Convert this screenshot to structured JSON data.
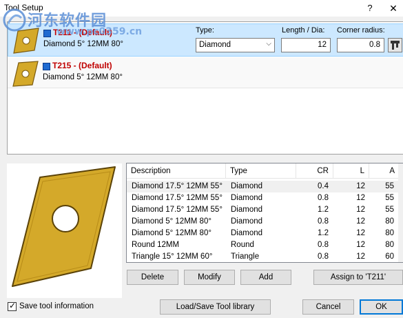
{
  "window": {
    "title": "Tool Setup",
    "help_label": "?",
    "close_label": "✕"
  },
  "watermark": {
    "text": "河东软件园",
    "url": "www.pc0359.cn"
  },
  "tools": [
    {
      "name": "T211 - (Default)",
      "description": "Diamond 5° 12MM 80°",
      "color": "#1f6bd1"
    },
    {
      "name": "T215 - (Default)",
      "description": "Diamond 5° 12MM 80°",
      "color": "#1f6bd1"
    }
  ],
  "selected_tool": {
    "type_label": "Type:",
    "type_value": "Diamond",
    "length_label": "Length / Dia:",
    "length_value": "12",
    "corner_label": "Corner radius:",
    "corner_value": "0.8"
  },
  "library": {
    "columns": [
      "Description",
      "Type",
      "CR",
      "L",
      "A"
    ],
    "rows": [
      [
        "Diamond 17.5° 12MM 55°",
        "Diamond",
        "0.4",
        "12",
        "55"
      ],
      [
        "Diamond 17.5° 12MM 55°",
        "Diamond",
        "0.8",
        "12",
        "55"
      ],
      [
        "Diamond 17.5° 12MM 55°",
        "Diamond",
        "1.2",
        "12",
        "55"
      ],
      [
        "Diamond 5° 12MM 80°",
        "Diamond",
        "0.8",
        "12",
        "80"
      ],
      [
        "Diamond 5° 12MM 80°",
        "Diamond",
        "1.2",
        "12",
        "80"
      ],
      [
        "Round 12MM",
        "Round",
        "0.8",
        "12",
        "80"
      ],
      [
        "Triangle 15° 12MM 60°",
        "Triangle",
        "0.8",
        "12",
        "60"
      ]
    ]
  },
  "buttons": {
    "delete": "Delete",
    "modify": "Modify",
    "add": "Add",
    "assign": "Assign to 'T211'",
    "load_save": "Load/Save Tool library",
    "cancel": "Cancel",
    "ok": "OK"
  },
  "save_tool_info": {
    "label": "Save tool information",
    "checked": true
  },
  "colors": {
    "insert_gold": "#d4a92a",
    "selection": "#cce8ff",
    "tool_color": "#1f6bd1"
  }
}
